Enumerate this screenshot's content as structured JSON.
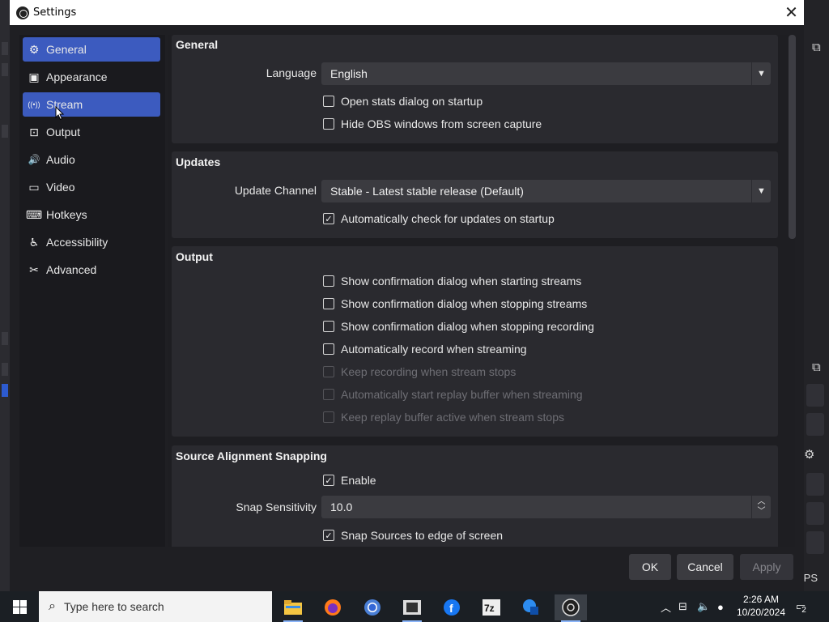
{
  "window": {
    "title": "Settings",
    "close_glyph": "✕"
  },
  "sidebar": {
    "items": [
      {
        "label": "General",
        "icon": "gear-icon",
        "glyph": "⚙"
      },
      {
        "label": "Appearance",
        "icon": "appearance-icon",
        "glyph": "▣"
      },
      {
        "label": "Stream",
        "icon": "antenna-icon",
        "glyph": "((•))"
      },
      {
        "label": "Output",
        "icon": "output-icon",
        "glyph": "⊡"
      },
      {
        "label": "Audio",
        "icon": "speaker-icon",
        "glyph": "🔊"
      },
      {
        "label": "Video",
        "icon": "monitor-icon",
        "glyph": "▭"
      },
      {
        "label": "Hotkeys",
        "icon": "keyboard-icon",
        "glyph": "⌨"
      },
      {
        "label": "Accessibility",
        "icon": "accessibility-icon",
        "glyph": "♿"
      },
      {
        "label": "Advanced",
        "icon": "wrench-icon",
        "glyph": "✂"
      }
    ]
  },
  "general": {
    "title": "General",
    "language_label": "Language",
    "language_value": "English",
    "open_stats": {
      "label": "Open stats dialog on startup",
      "checked": false
    },
    "hide_obs": {
      "label": "Hide OBS windows from screen capture",
      "checked": false
    }
  },
  "updates": {
    "title": "Updates",
    "channel_label": "Update Channel",
    "channel_value": "Stable - Latest stable release (Default)",
    "auto_check": {
      "label": "Automatically check for updates on startup",
      "checked": true
    }
  },
  "output": {
    "title": "Output",
    "options": [
      {
        "label": "Show confirmation dialog when starting streams",
        "checked": false,
        "disabled": false
      },
      {
        "label": "Show confirmation dialog when stopping streams",
        "checked": false,
        "disabled": false
      },
      {
        "label": "Show confirmation dialog when stopping recording",
        "checked": false,
        "disabled": false
      },
      {
        "label": "Automatically record when streaming",
        "checked": false,
        "disabled": false
      },
      {
        "label": "Keep recording when stream stops",
        "checked": false,
        "disabled": true
      },
      {
        "label": "Automatically start replay buffer when streaming",
        "checked": false,
        "disabled": true
      },
      {
        "label": "Keep replay buffer active when stream stops",
        "checked": false,
        "disabled": true
      }
    ]
  },
  "snapping": {
    "title": "Source Alignment Snapping",
    "enable": {
      "label": "Enable",
      "checked": true
    },
    "sensitivity_label": "Snap Sensitivity",
    "sensitivity_value": "10.0",
    "snap_edge": {
      "label": "Snap Sources to edge of screen",
      "checked": true
    }
  },
  "buttons": {
    "ok": "OK",
    "cancel": "Cancel",
    "apply": "Apply"
  },
  "background": {
    "ps_text": "PS"
  },
  "taskbar": {
    "search_placeholder": "Type here to search",
    "time": "2:26 AM",
    "date": "10/20/2024",
    "notification_count": "2"
  },
  "colors": {
    "accent": "#3c5bbf",
    "dialog_bg": "#1f1f23",
    "group_bg": "#2a2a2f"
  }
}
